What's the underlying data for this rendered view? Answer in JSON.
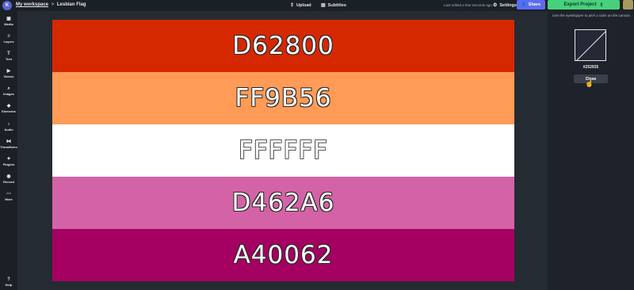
{
  "header": {
    "logo_text": "K",
    "workspace_label": "My workspace",
    "separator": ">",
    "project_title": "Lesbian Flag",
    "upload_label": "Upload",
    "subtitles_label": "Subtitles",
    "edited_status": "Last edited a few seconds ago.",
    "settings_label": "Settings",
    "share_label": "Share",
    "export_label": "Export Project"
  },
  "sidebar": {
    "items": [
      {
        "label": "Media",
        "icon": "media-icon"
      },
      {
        "label": "Layers",
        "icon": "layers-icon"
      },
      {
        "label": "Text",
        "icon": "text-icon"
      },
      {
        "label": "Videos",
        "icon": "videos-icon"
      },
      {
        "label": "Images",
        "icon": "images-icon"
      },
      {
        "label": "Elements",
        "icon": "elements-icon"
      },
      {
        "label": "Audio",
        "icon": "audio-icon"
      },
      {
        "label": "Transitions",
        "icon": "transitions-icon"
      },
      {
        "label": "Plugins",
        "icon": "plugins-icon"
      },
      {
        "label": "Record",
        "icon": "record-icon"
      },
      {
        "label": "More",
        "icon": "more-icon"
      }
    ],
    "help_label": "Help"
  },
  "flag": {
    "stripes": [
      {
        "text": "D62800",
        "color": "#D62800"
      },
      {
        "text": "FF9B56",
        "color": "#FF9B56"
      },
      {
        "text": "FFFFFF",
        "color": "#FFFFFF"
      },
      {
        "text": "D462A6",
        "color": "#D462A6"
      },
      {
        "text": "A40062",
        "color": "#A40062"
      }
    ]
  },
  "color_panel": {
    "hint": "Use the eyedropper to pick a color on the canvas.",
    "hex_value": "#252935",
    "close_label": "Close"
  },
  "colors": {
    "background": "#1b1f26",
    "share_accent": "#5b6cf0",
    "export_accent": "#47d17d"
  }
}
